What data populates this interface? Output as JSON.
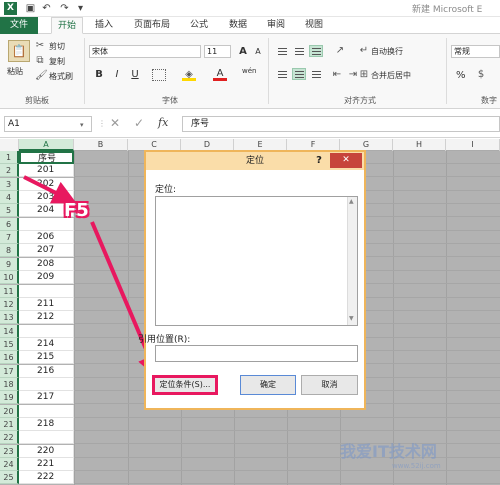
{
  "app": {
    "title": "新建 Microsoft E",
    "logo": "X"
  },
  "quick_access": [
    "save-icon",
    "undo-icon",
    "redo-icon"
  ],
  "tabs": [
    {
      "label": "文件"
    },
    {
      "label": "开始"
    },
    {
      "label": "插入"
    },
    {
      "label": "页面布局"
    },
    {
      "label": "公式"
    },
    {
      "label": "数据"
    },
    {
      "label": "审阅"
    },
    {
      "label": "视图"
    }
  ],
  "ribbon": {
    "clipboard": {
      "paste": "粘贴",
      "cut": "剪切",
      "copy": "复制",
      "format_painter": "格式刷",
      "group": "剪贴板"
    },
    "font": {
      "name": "宋体",
      "size": "11",
      "bold": "B",
      "italic": "I",
      "underline": "U",
      "group": "字体",
      "grow": "A",
      "shrink": "A",
      "color_a": "A",
      "wen": "wén"
    },
    "alignment": {
      "wrap": "自动换行",
      "merge": "合并后居中",
      "group": "对齐方式"
    },
    "number": {
      "format": "常规",
      "percent": "%",
      "group": "数字"
    }
  },
  "formula_bar": {
    "name_box": "A1",
    "fx": "fx",
    "content": "序号"
  },
  "columns": [
    "A",
    "B",
    "C",
    "D",
    "E",
    "F",
    "G",
    "H",
    "I"
  ],
  "rows": [
    {
      "num": "1",
      "a": "序号"
    },
    {
      "num": "2",
      "a": "201"
    },
    {
      "num": "3",
      "a": "202"
    },
    {
      "num": "4",
      "a": "203"
    },
    {
      "num": "5",
      "a": "204"
    },
    {
      "num": "6",
      "a": ""
    },
    {
      "num": "7",
      "a": "206"
    },
    {
      "num": "8",
      "a": "207"
    },
    {
      "num": "9",
      "a": "208"
    },
    {
      "num": "10",
      "a": "209"
    },
    {
      "num": "11",
      "a": ""
    },
    {
      "num": "12",
      "a": "211"
    },
    {
      "num": "13",
      "a": "212"
    },
    {
      "num": "14",
      "a": ""
    },
    {
      "num": "15",
      "a": "214"
    },
    {
      "num": "16",
      "a": "215"
    },
    {
      "num": "17",
      "a": "216"
    },
    {
      "num": "18",
      "a": ""
    },
    {
      "num": "19",
      "a": "217"
    },
    {
      "num": "20",
      "a": ""
    },
    {
      "num": "21",
      "a": "218"
    },
    {
      "num": "22",
      "a": ""
    },
    {
      "num": "23",
      "a": "220"
    },
    {
      "num": "24",
      "a": "221"
    },
    {
      "num": "25",
      "a": "222"
    }
  ],
  "dialog": {
    "title": "定位",
    "help": "?",
    "close": "✕",
    "goto_label": "定位:",
    "ref_label": "引用位置(R):",
    "special_button": "定位条件(S)...",
    "ok_button": "确定",
    "cancel_button": "取消"
  },
  "annotation": {
    "key": "F5",
    "color": "#e8185f"
  },
  "watermark": {
    "text": "我爱IT技术网",
    "sub": "www.52ij.com"
  }
}
